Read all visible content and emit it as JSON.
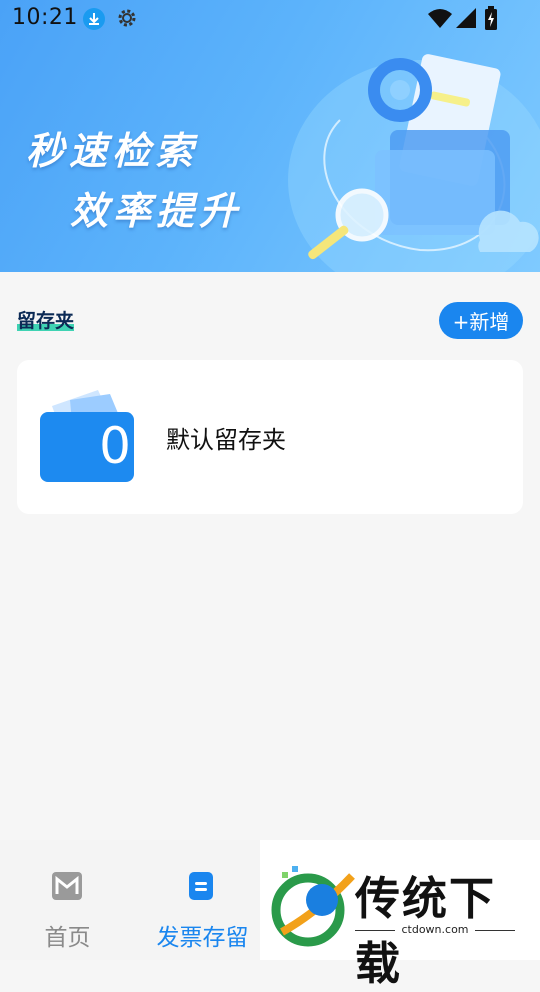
{
  "status_bar": {
    "time": "10:21",
    "icons": [
      "download-icon",
      "gear-icon",
      "wifi-icon",
      "signal-icon",
      "battery-icon"
    ]
  },
  "banner": {
    "line1": "秒速检索",
    "line2": "效率提升"
  },
  "section": {
    "title": "留存夹",
    "add_label": "+新增"
  },
  "folders": [
    {
      "count": "0",
      "name": "默认留存夹"
    }
  ],
  "tabs": [
    {
      "label": "首页",
      "icon": "home-m-icon",
      "active": false
    },
    {
      "label": "发票存留",
      "icon": "invoice-icon",
      "active": true
    }
  ],
  "watermark": {
    "title": "传统下载",
    "url": "ctdown.com"
  },
  "colors": {
    "accent": "#1a86ef",
    "banner": "#5cb3fb",
    "highlight": "#3fd3b3"
  }
}
